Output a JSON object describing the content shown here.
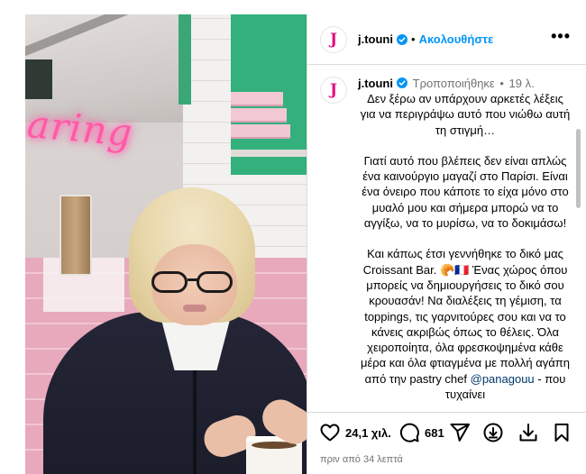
{
  "post": {
    "username": "j.touni",
    "avatar_letter": "J",
    "follow_label": "Ακολουθήστε",
    "separator": "•",
    "more_label": "•••"
  },
  "caption": {
    "username": "j.touni",
    "edited_label": "Τροποποιήθηκε",
    "age": "19 λ.",
    "paragraphs": [
      "Δεν ξέρω αν υπάρχουν αρκετές λέξεις για να περιγράψω αυτό που νιώθω αυτή τη στιγμή…",
      "Γιατί αυτό που βλέπεις δεν είναι απλώς ένα καινούργιο μαγαζί στο Παρίσι. Είναι ένα όνειρο που κάποτε το είχα μόνο στο μυαλό μου και σήμερα μπορώ να το αγγίξω, να το μυρίσω, να το δοκιμάσω!",
      "Και κάπως έτσι γεννήθηκε το δικό μας Croissant Bar. 🥐🇫🇷 Ένας χώρος όπου μπορείς να δημιουργήσεις το δικό σου κρουασάν! Να διαλέξεις τη γέμιση, τα toppings, τις γαρνιτούρες σου και να το κάνεις ακριβώς όπως το θέλεις. Όλα χειροποίητα, όλα φρεσκοψημένα κάθε μέρα και όλα φτιαγμένα με πολλή αγάπη από την pastry chef",
      "@panagouu",
      "- που τυχαίνει"
    ]
  },
  "photo": {
    "neon_text": "aring"
  },
  "actions": {
    "likes": "24,1 χιλ.",
    "comments": "681",
    "posted": "πριν από 34 λεπτά"
  },
  "icons": {
    "like": "heart-icon",
    "comment": "comment-icon",
    "share": "send-icon",
    "remix": "download-circle-icon",
    "download": "download-icon",
    "save": "bookmark-icon"
  },
  "colors": {
    "link": "#0095f6",
    "brand": "#e3107e",
    "muted": "#737373",
    "border": "#dbdbdb"
  }
}
